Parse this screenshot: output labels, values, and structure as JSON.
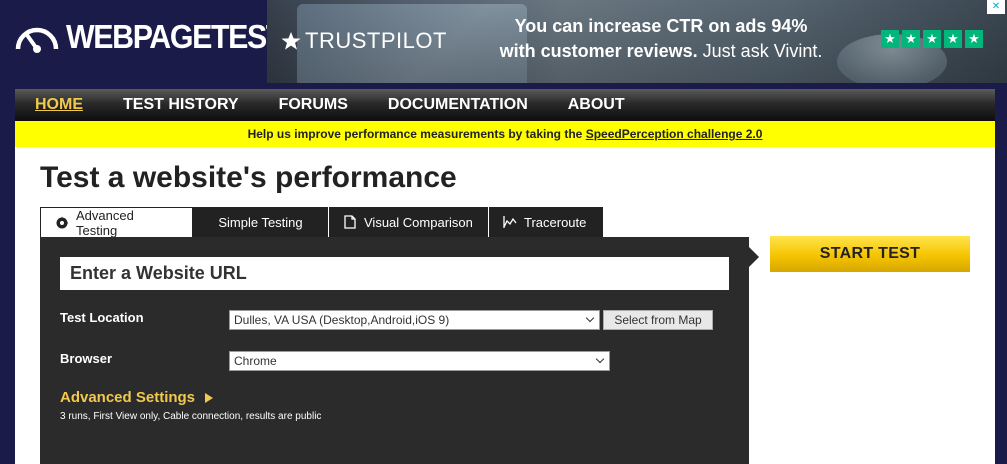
{
  "brand": {
    "name": "WEBPAGETEST"
  },
  "ad": {
    "brand": "TRUSTPILOT",
    "line1": "You can increase CTR on ads 94%",
    "line2_bold": "with customer reviews.",
    "line2_rest": " Just ask Vivint.",
    "stars": [
      "★",
      "★",
      "★",
      "★",
      "★"
    ],
    "close": "✕",
    "colors": {
      "star_bg": "#00b67a"
    }
  },
  "nav": {
    "items": [
      {
        "label": "HOME",
        "active": true
      },
      {
        "label": "TEST HISTORY"
      },
      {
        "label": "FORUMS"
      },
      {
        "label": "DOCUMENTATION"
      },
      {
        "label": "ABOUT"
      }
    ]
  },
  "banner": {
    "text": "Help us improve performance measurements by taking the ",
    "link": "SpeedPerception challenge 2.0"
  },
  "page": {
    "title": "Test a website's performance"
  },
  "tabs": [
    {
      "label": "Advanced Testing",
      "icon": "gear-icon",
      "active": true
    },
    {
      "label": "Simple Testing"
    },
    {
      "label": "Visual Comparison",
      "icon": "document-icon"
    },
    {
      "label": "Traceroute",
      "icon": "trace-icon"
    }
  ],
  "form": {
    "url_placeholder": "Enter a Website URL",
    "location_label": "Test Location",
    "location_value": "Dulles, VA USA (Desktop,Android,iOS 9)",
    "map_button": "Select from Map",
    "browser_label": "Browser",
    "browser_value": "Chrome",
    "advanced_label": "Advanced Settings",
    "advanced_note": "3 runs, First View only, Cable connection, results are public"
  },
  "actions": {
    "start": "START TEST"
  },
  "colors": {
    "accent": "#f2c94c",
    "banner": "#ffff00",
    "header": "#1b1b4a",
    "panel": "#2b2b2b"
  }
}
